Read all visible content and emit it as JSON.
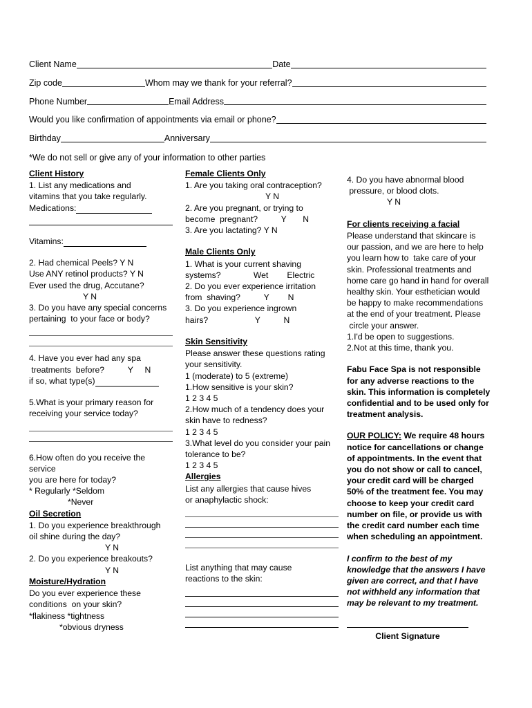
{
  "header": {
    "rows": [
      {
        "labels": [
          "Client Name",
          "Date"
        ]
      },
      {
        "labels": [
          "Zip code",
          "Whom may we thank for your referral?"
        ]
      },
      {
        "labels": [
          "Phone Number",
          " Email Address"
        ]
      },
      {
        "labels": [
          "Would you like confirmation of appointments via email or phone?"
        ]
      },
      {
        "labels": [
          "Birthday ",
          "Anniversary"
        ]
      }
    ],
    "client_name_label": "Client Name",
    "date_label": "Date",
    "zip_label": "Zip code",
    "referral_label": "Whom may we thank for your referral?",
    "phone_label": "Phone Number",
    "email_label": " Email Address",
    "confirmation_label": "Would you like confirmation of appointments via email or phone?",
    "birthday_label": "Birthday ",
    "anniversary_label": "Anniversary",
    "privacy_note": "*We do not sell or give any of your information to other parties"
  },
  "left_column": {
    "client_history": {
      "heading": " Client History",
      "q1": "1. List any medications and\nvitamins that you take regularly.",
      "medications_label": "Medications:",
      "vitamins_label": "Vitamins:",
      "q2_peels": "2. Had chemical Peels?  Y     N",
      "q2_retinol": "Use ANY retinol products?    Y   N",
      "q2_accutane": "Ever used the drug, Accutane?",
      "q2_accutane_yn": "Y    N",
      "q3": "3. Do you have any special concerns\npertaining  to your face or body?",
      "q4": "4. Have you ever had any spa\n treatments  before?          Y     N",
      "q4_type_label": "if so, what type(s)",
      "q5": "5.What is your primary reason for\nreceiving your service today?",
      "q6": "6.How often do you receive the service\nyou are here for today?",
      "q6_opt1": "* Regularly          *Seldom",
      "q6_opt2": "*Never"
    },
    "oil_secretion": {
      "heading": "Oil Secretion",
      "q1": "1. Do you experience breakthrough\noil shine during the day?",
      "q1_yn": "Y       N",
      "q2": "2. Do you experience breakouts?",
      "q2_yn": "Y       N"
    },
    "moisture": {
      "heading": "Moisture/Hydration",
      "q1": "Do you ever experience these\nconditions  on your skin?",
      "opt1": "*flakiness             *tightness",
      "opt2": "*obvious dryness"
    }
  },
  "mid_column": {
    "female": {
      "heading": "Female Clients Only",
      "q1": "1. Are you taking oral contraception?",
      "q1_yn": "Y     N",
      "q2": "2. Are you pregnant, or trying to\nbecome  pregnant?          Y       N",
      "q3": "3. Are you lactating?          Y       N"
    },
    "male": {
      "heading": "Male Clients Only",
      "q1": "1. What is your current shaving\nsystems?              Wet        Electric",
      "q2": "2. Do you ever experience irritation\nfrom  shaving?          Y        N",
      "q3": "3. Do you experience ingrown\nhairs?                    Y          N"
    },
    "skin_sensitivity": {
      "heading": "Skin Sensitivity ",
      "intro": "Please answer these questions rating\nyour sensitivity.",
      "scale_note": " 1 (moderate) to 5 (extreme)",
      "q1": "1.How sensitive is your skin?",
      "q1_scale": "1     2     3    4    5",
      "q2": "2.How much of a tendency does your\nskin have to redness?",
      "q2_scale": "1     2     3    4    5",
      "q3": "3.What level do you consider your pain\ntolerance to be?",
      "q3_scale": "1     2     3    4    5"
    },
    "allergies": {
      "heading": "Allergies",
      "q1": "List any allergies that cause hives\nor anaphylactic shock:",
      "q2": "List anything that may cause\nreactions to the skin:"
    }
  },
  "right_column": {
    "q4_blood": "4. Do you have abnormal blood\n pressure, or blood clots.",
    "q4_blood_yn": "Y                N",
    "facial": {
      "heading": "For clients receiving a facial",
      "body": "Please understand that skincare is\nour passion, and we are here to help\nyou learn how to  take care of your\nskin. Professional treatments and\nhome care go hand in hand for overall\nhealthy skin. Your esthetician would\nbe happy to make recommendations\nat the end of your treatment. Please\n circle your answer.",
      "opt1": "1.I'd be open to suggestions.",
      "opt2": "2.Not at this time, thank you."
    },
    "liability": "Fabu Face Spa is not responsible for any adverse reactions to the skin. This information is completely confidential and to be used only for treatment analysis.",
    "policy_label": "OUR POLICY:",
    "policy_body": " We require 48 hours notice for cancellations or change of appointments. In the event that you do not show or call to cancel, your credit card will be charged 50% of the treatment fee. You may choose to keep your credit card number on file, or provide us with the credit card number each time when scheduling an appointment.",
    "confirmation": "I confirm to the best of my knowledge that the answers I have given are correct, and that I have not withheld any information that may be relevant to my treatment.",
    "signature_caption": "Client Signature"
  }
}
